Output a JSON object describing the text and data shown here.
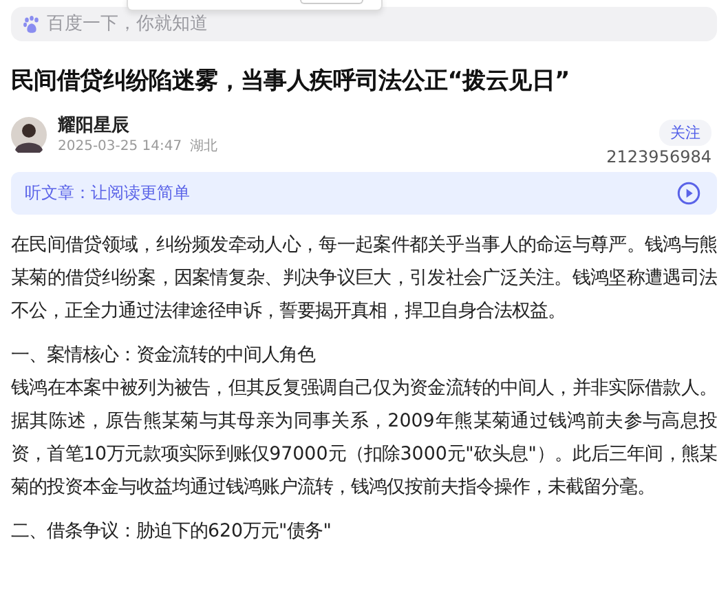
{
  "search": {
    "placeholder": "百度一下，你就知道"
  },
  "popup": {
    "kind": "dialog"
  },
  "article": {
    "title": "民间借贷纠纷陷迷雾，当事人疾呼司法公正“拨云见日”",
    "author": {
      "name": "耀阳星辰",
      "date": "2025-03-25 14:47",
      "location": "湖北",
      "follow": "关注",
      "count": "2123956984"
    },
    "listen": {
      "label": "听文章：让阅读更简单"
    },
    "blocks": [
      {
        "kind": "paragraph",
        "text": "在民间借贷领域，纠纷频发牵动人心，每一起案件都关乎当事人的命运与尊严。钱鸿与熊某菊的借贷纠纷案，因案情复杂、判决争议巨大，引发社会广泛关注。钱鸿坚称遭遇司法不公，正全力通过法律途径申诉，誓要揭开真相，捍卫自身合法权益。"
      },
      {
        "kind": "heading",
        "text": "一、案情核心：资金流转的中间人角色"
      },
      {
        "kind": "paragraph",
        "text": "钱鸿在本案中被列为被告，但其反复强调自己仅为资金流转的中间人，并非实际借款人。据其陈述，原告熊某菊与其母亲为同事关系，2009年熊某菊通过钱鸿前夫参与高息投资，首笔10万元款项实际到账仅97000元（扣除3000元\"砍头息\"）。此后三年间，熊某菊的投资本金与收益均通过钱鸿账户流转，钱鸿仅按前夫指令操作，未截留分毫。"
      },
      {
        "kind": "heading",
        "text": "二、借条争议：胁迫下的620万元\"债务\""
      }
    ]
  }
}
